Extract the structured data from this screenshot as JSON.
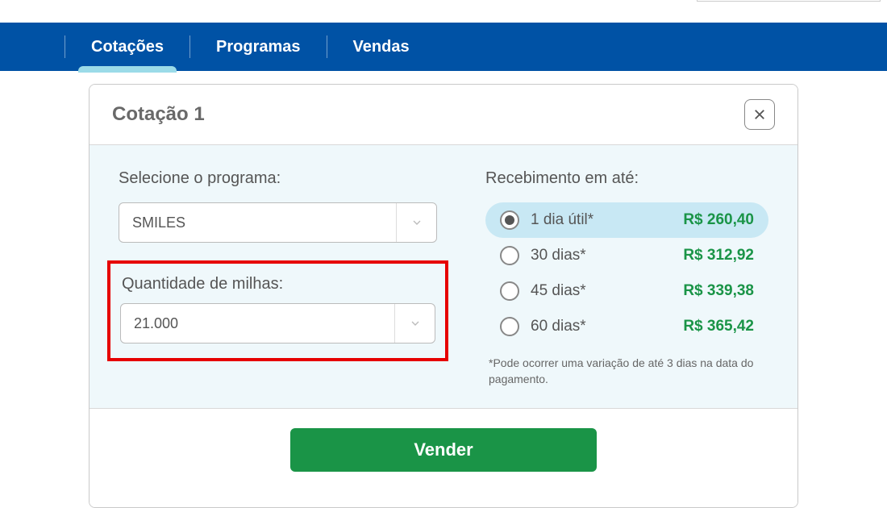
{
  "nav": {
    "items": [
      {
        "label": "Cotações",
        "active": true
      },
      {
        "label": "Programas",
        "active": false
      },
      {
        "label": "Vendas",
        "active": false
      }
    ]
  },
  "panel": {
    "title": "Cotação 1",
    "program_label": "Selecione o programa:",
    "program_value": "SMILES",
    "quantity_label": "Quantidade de milhas:",
    "quantity_value": "21.000",
    "receive_label": "Recebimento em até:",
    "options": [
      {
        "label": "1 dia útil*",
        "price": "R$ 260,40",
        "selected": true
      },
      {
        "label": "30 dias*",
        "price": "R$ 312,92",
        "selected": false
      },
      {
        "label": "45 dias*",
        "price": "R$ 339,38",
        "selected": false
      },
      {
        "label": "60 dias*",
        "price": "R$ 365,42",
        "selected": false
      }
    ],
    "disclaimer": "*Pode ocorrer uma variação de até 3 dias na data do pagamento.",
    "sell_label": "Vender"
  }
}
